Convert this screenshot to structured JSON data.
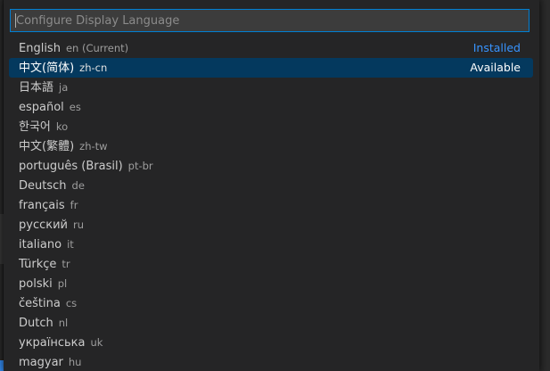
{
  "picker": {
    "placeholder": "Configure Display Language",
    "value": ""
  },
  "languages": [
    {
      "label": "English",
      "code": "en (Current)",
      "status": "Installed",
      "selected": false
    },
    {
      "label": "中文(简体)",
      "code": "zh-cn",
      "status": "Available",
      "selected": true
    },
    {
      "label": "日本語",
      "code": "ja",
      "status": "",
      "selected": false
    },
    {
      "label": "español",
      "code": "es",
      "status": "",
      "selected": false
    },
    {
      "label": "한국어",
      "code": "ko",
      "status": "",
      "selected": false
    },
    {
      "label": "中文(繁體)",
      "code": "zh-tw",
      "status": "",
      "selected": false
    },
    {
      "label": "português (Brasil)",
      "code": "pt-br",
      "status": "",
      "selected": false
    },
    {
      "label": "Deutsch",
      "code": "de",
      "status": "",
      "selected": false
    },
    {
      "label": "français",
      "code": "fr",
      "status": "",
      "selected": false
    },
    {
      "label": "русский",
      "code": "ru",
      "status": "",
      "selected": false
    },
    {
      "label": "italiano",
      "code": "it",
      "status": "",
      "selected": false
    },
    {
      "label": "Türkçe",
      "code": "tr",
      "status": "",
      "selected": false
    },
    {
      "label": "polski",
      "code": "pl",
      "status": "",
      "selected": false
    },
    {
      "label": "čeština",
      "code": "cs",
      "status": "",
      "selected": false
    },
    {
      "label": "Dutch",
      "code": "nl",
      "status": "",
      "selected": false
    },
    {
      "label": "українська",
      "code": "uk",
      "status": "",
      "selected": false
    },
    {
      "label": "magyar",
      "code": "hu",
      "status": "",
      "selected": false
    }
  ],
  "colors": {
    "focus_border": "#007fd4",
    "selected_bg": "#04395e",
    "status_link": "#3794ff"
  }
}
